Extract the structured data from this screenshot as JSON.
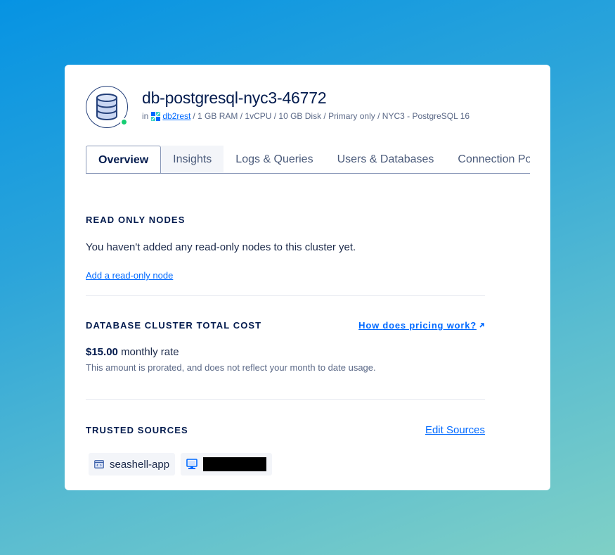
{
  "header": {
    "title": "db-postgresql-nyc3-46772",
    "meta_prefix": "in",
    "project_name": "db2rest",
    "meta_details": "/ 1 GB RAM / 1vCPU / 10 GB Disk / Primary only / NYC3 - PostgreSQL 16",
    "status": "online",
    "status_color": "#15cd72"
  },
  "tabs": [
    {
      "label": "Overview",
      "active": true
    },
    {
      "label": "Insights",
      "active": false
    },
    {
      "label": "Logs & Queries",
      "active": false
    },
    {
      "label": "Users & Databases",
      "active": false
    },
    {
      "label": "Connection Poo",
      "active": false
    }
  ],
  "read_only_nodes": {
    "title": "READ ONLY NODES",
    "empty_message": "You haven't added any read-only nodes to this cluster yet.",
    "add_link": "Add a read-only node"
  },
  "cost": {
    "title": "DATABASE CLUSTER TOTAL COST",
    "pricing_link": "How does pricing work?",
    "amount": "$15.00",
    "rate_label": "monthly rate",
    "note": "This amount is prorated, and does not reflect your month to date usage."
  },
  "trusted_sources": {
    "title": "TRUSTED SOURCES",
    "edit_link": "Edit Sources",
    "sources": [
      {
        "type": "app",
        "label": "seashell-app"
      },
      {
        "type": "droplet",
        "label": "[redacted]"
      }
    ]
  },
  "colors": {
    "accent": "#0069ff",
    "text_primary": "#031b4e",
    "text_secondary": "#5b6987"
  }
}
